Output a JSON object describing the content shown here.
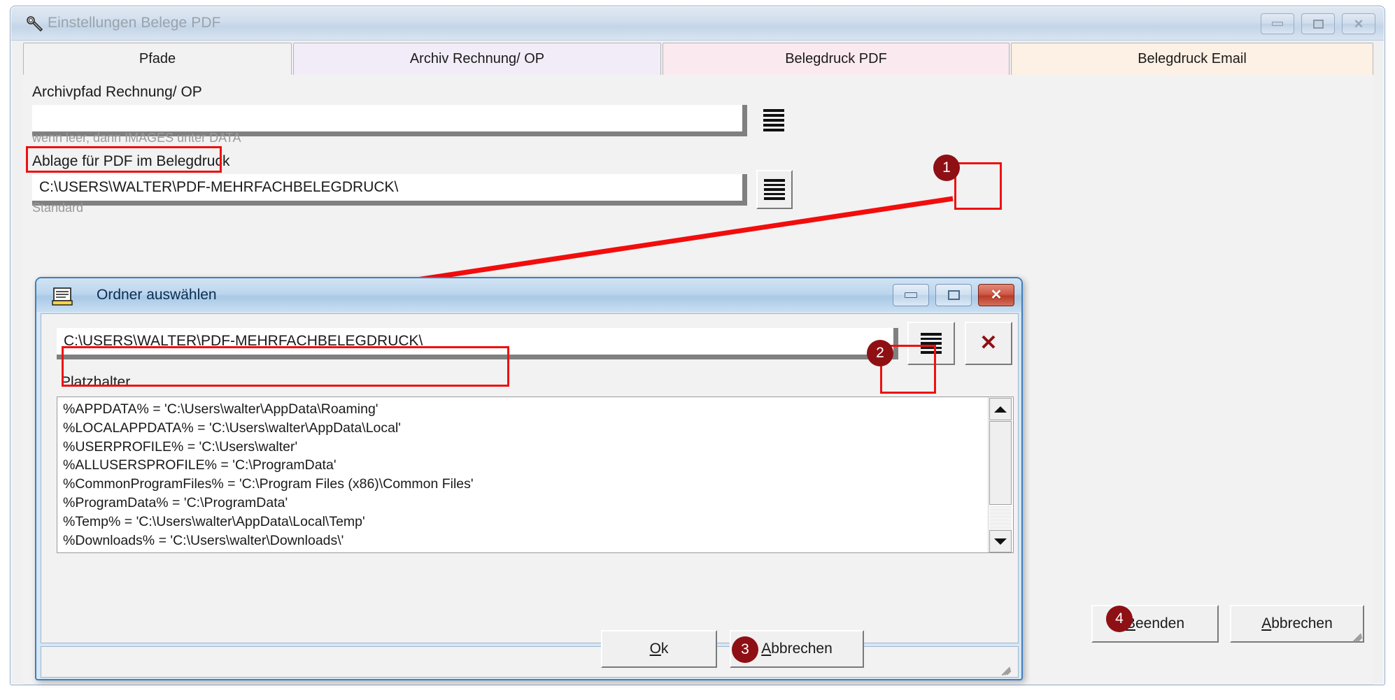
{
  "main_window": {
    "title": "Einstellungen Belege PDF",
    "title_icon": "wrench-icon",
    "controls": {
      "minimize": "–",
      "maximize": "□",
      "close": "✕"
    },
    "tabs": [
      {
        "label": "Pfade",
        "active": true
      },
      {
        "label": "Archiv Rechnung/ OP",
        "active": false
      },
      {
        "label": "Belegdruck PDF",
        "active": false
      },
      {
        "label": "Belegdruck Email",
        "active": false
      }
    ],
    "fields": [
      {
        "label": "Archivpfad Rechnung/ OP",
        "value": "",
        "hint": "wenn leer, dann IMAGES unter DATA",
        "browse_icon": "list-lines-icon"
      },
      {
        "label": "Ablage für PDF im Belegdruck",
        "value": "C:\\USERS\\WALTER\\PDF-MEHRFACHBELEGDRUCK\\",
        "hint": "Standard",
        "browse_icon": "list-lines-icon"
      }
    ],
    "buttons": {
      "finish": "Beenden",
      "cancel": "Abbrechen"
    }
  },
  "dialog": {
    "title": "Ordner auswählen",
    "title_icon": "folder-window-icon",
    "controls": {
      "minimize": "–",
      "maximize": "□",
      "close": "✕"
    },
    "path_value": "C:\\USERS\\WALTER\\PDF-MEHRFACHBELEGDRUCK\\",
    "browse_icon": "list-lines-icon",
    "clear_icon": "x-icon",
    "placeholder_label": "Platzhalter",
    "placeholders": [
      "%APPDATA% = 'C:\\Users\\walter\\AppData\\Roaming'",
      "%LOCALAPPDATA% = 'C:\\Users\\walter\\AppData\\Local'",
      "%USERPROFILE% = 'C:\\Users\\walter'",
      "%ALLUSERSPROFILE% = 'C:\\ProgramData'",
      "%CommonProgramFiles% = 'C:\\Program Files (x86)\\Common Files'",
      "%ProgramData% = 'C:\\ProgramData'",
      "%Temp% = 'C:\\Users\\walter\\AppData\\Local\\Temp'",
      "%Downloads% = 'C:\\Users\\walter\\Downloads\\'"
    ],
    "buttons": {
      "ok": "Ok",
      "cancel": "Abbrechen"
    }
  },
  "annotations": {
    "badges": [
      {
        "number": "1"
      },
      {
        "number": "2"
      },
      {
        "number": "3"
      },
      {
        "number": "4"
      }
    ],
    "highlight_color": "#ee1111",
    "badge_color": "#8e1014"
  }
}
